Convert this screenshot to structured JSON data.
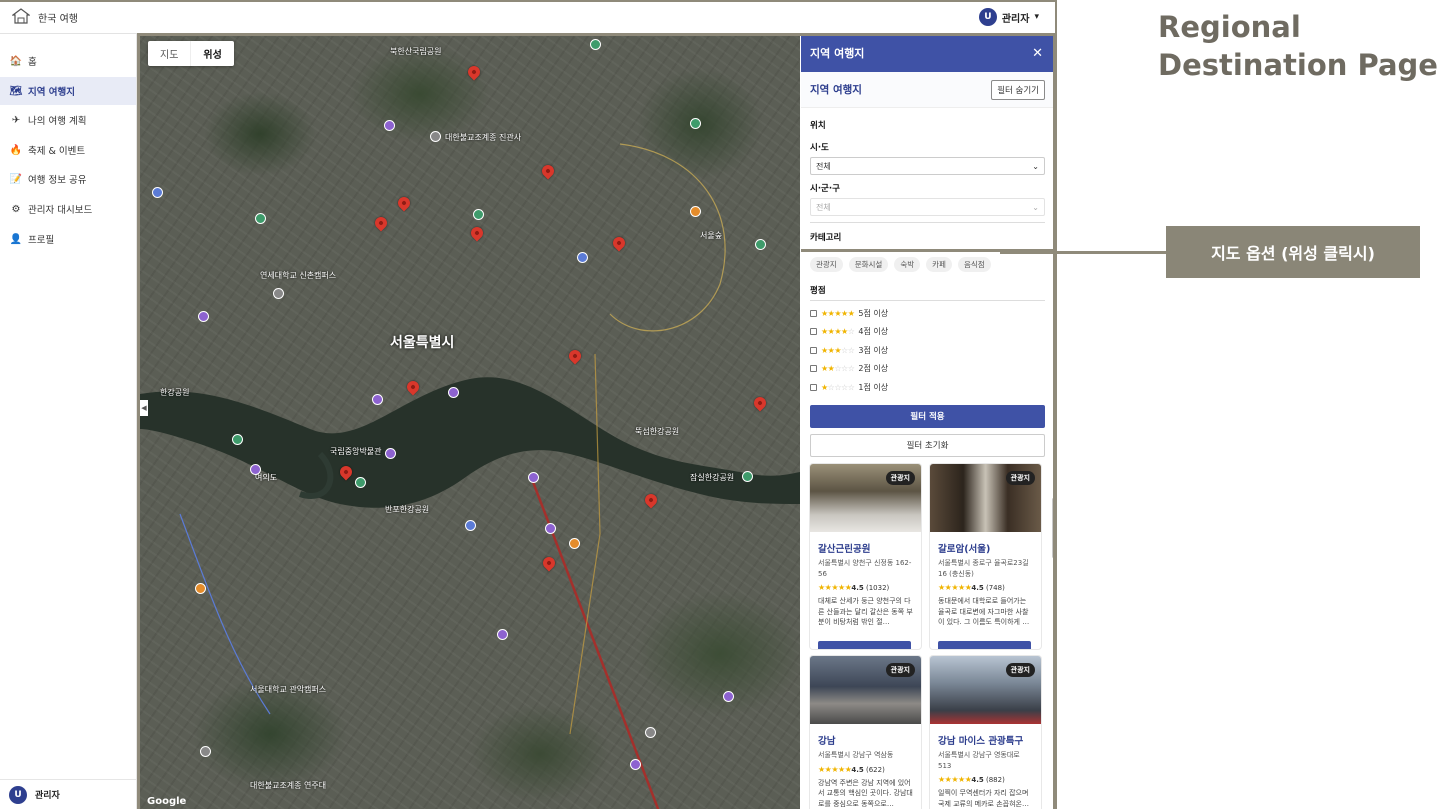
{
  "header": {
    "app_title": "한국 여행",
    "user_initial": "U",
    "user_name": "관리자",
    "user_caret": "▾"
  },
  "sidebar": {
    "items": [
      {
        "label": "홈",
        "icon": "🏠"
      },
      {
        "label": "지역 여행지",
        "icon": "🗺"
      },
      {
        "label": "나의 여행 계획",
        "icon": "✈"
      },
      {
        "label": "축제 & 이벤트",
        "icon": "🔥"
      },
      {
        "label": "여행 정보 공유",
        "icon": "📝"
      },
      {
        "label": "관리자 대시보드",
        "icon": "⚙"
      },
      {
        "label": "프로필",
        "icon": "👤"
      }
    ],
    "footer_initial": "U",
    "footer_name": "관리자"
  },
  "map": {
    "tabs": [
      "지도",
      "위성"
    ],
    "active_tab": "위성",
    "city_label": "서울특별시",
    "attribution": "Google",
    "place_labels": [
      {
        "text": "북한산국립공원"
      },
      {
        "text": "대한불교조계종 진관사"
      },
      {
        "text": "연세대학교 신촌캠퍼스"
      },
      {
        "text": "한강공원"
      },
      {
        "text": "여의도"
      },
      {
        "text": "반포한강공원"
      },
      {
        "text": "서울대학교 관악캠퍼스"
      },
      {
        "text": "잠실한강공원"
      },
      {
        "text": "뚝섬한강공원"
      },
      {
        "text": "국립중앙박물관"
      },
      {
        "text": "서울숲"
      },
      {
        "text": "대한불교조계종 연주대"
      }
    ]
  },
  "panel": {
    "header_title": "지역 여행지",
    "close_label": "✕",
    "sub_title": "지역 여행지",
    "hide_filter": "필터 숨기기",
    "location_label": "위치",
    "sido_label": "시·도",
    "sido_value": "전체",
    "sigungu_label": "시·군·구",
    "sigungu_value": "전체",
    "category_label": "카테고리",
    "categories": [
      "관광지",
      "문화시설",
      "숙박",
      "카페",
      "음식점"
    ],
    "rating_label": "평점",
    "ratings": [
      {
        "stars": "★★★★★",
        "off": "",
        "text": "5점 이상"
      },
      {
        "stars": "★★★★",
        "off": "☆",
        "text": "4점 이상"
      },
      {
        "stars": "★★★",
        "off": "☆☆",
        "text": "3점 이상"
      },
      {
        "stars": "★★",
        "off": "☆☆☆",
        "text": "2점 이상"
      },
      {
        "stars": "★",
        "off": "☆☆☆☆",
        "text": "1점 이상"
      }
    ],
    "apply_label": "필터 적용",
    "reset_label": "필터 초기화",
    "cards": [
      {
        "badge": "관광지",
        "name": "갈산근린공원",
        "address": "서울특별시 양천구 신정동 162-56",
        "stars": "★★★★★",
        "rating": "4.5",
        "count": "(1032)",
        "desc": "대체로 산세가 둥근 양천구의 다른 산들과는 달리 갈산은 동쪽 부분이 비탕처럼 밖인 절…"
      },
      {
        "badge": "관광지",
        "name": "갈로암(서울)",
        "address": "서울특별시 종로구 율곡로23길 16 (충신동)",
        "stars": "★★★★★",
        "rating": "4.5",
        "count": "(748)",
        "desc": "동대문에서 대학로로 들어가는 율곡로 대로변에 자그마한 사찰이 있다. 그 이름도 특이하게 …"
      },
      {
        "badge": "관광지",
        "name": "강남",
        "address": "서울특별시 강남구 역삼동",
        "stars": "★★★★★",
        "rating": "4.5",
        "count": "(622)",
        "desc": "강남역 주변은 강남 지역에 있어서 교통의 핵심인 곳이다. 강남대로를 중심으로 동쪽으로…"
      },
      {
        "badge": "관광지",
        "name": "강남 마이스 관광특구",
        "address": "서울특별시 강남구 영동대로 513",
        "stars": "★★★★★",
        "rating": "4.5",
        "count": "(882)",
        "desc": "일찍이 무역센터가 자리 잡으며 국제 교류의 메카로 손꼽혀온…"
      }
    ]
  },
  "annotation": {
    "title_line1": "Regional",
    "title_line2": "Destination Page",
    "callout": "지도 옵션 (위성 클릭시)"
  },
  "colors": {
    "primary": "#3f52a6",
    "annotation": "#8a8677",
    "pin": "#d9372b"
  }
}
